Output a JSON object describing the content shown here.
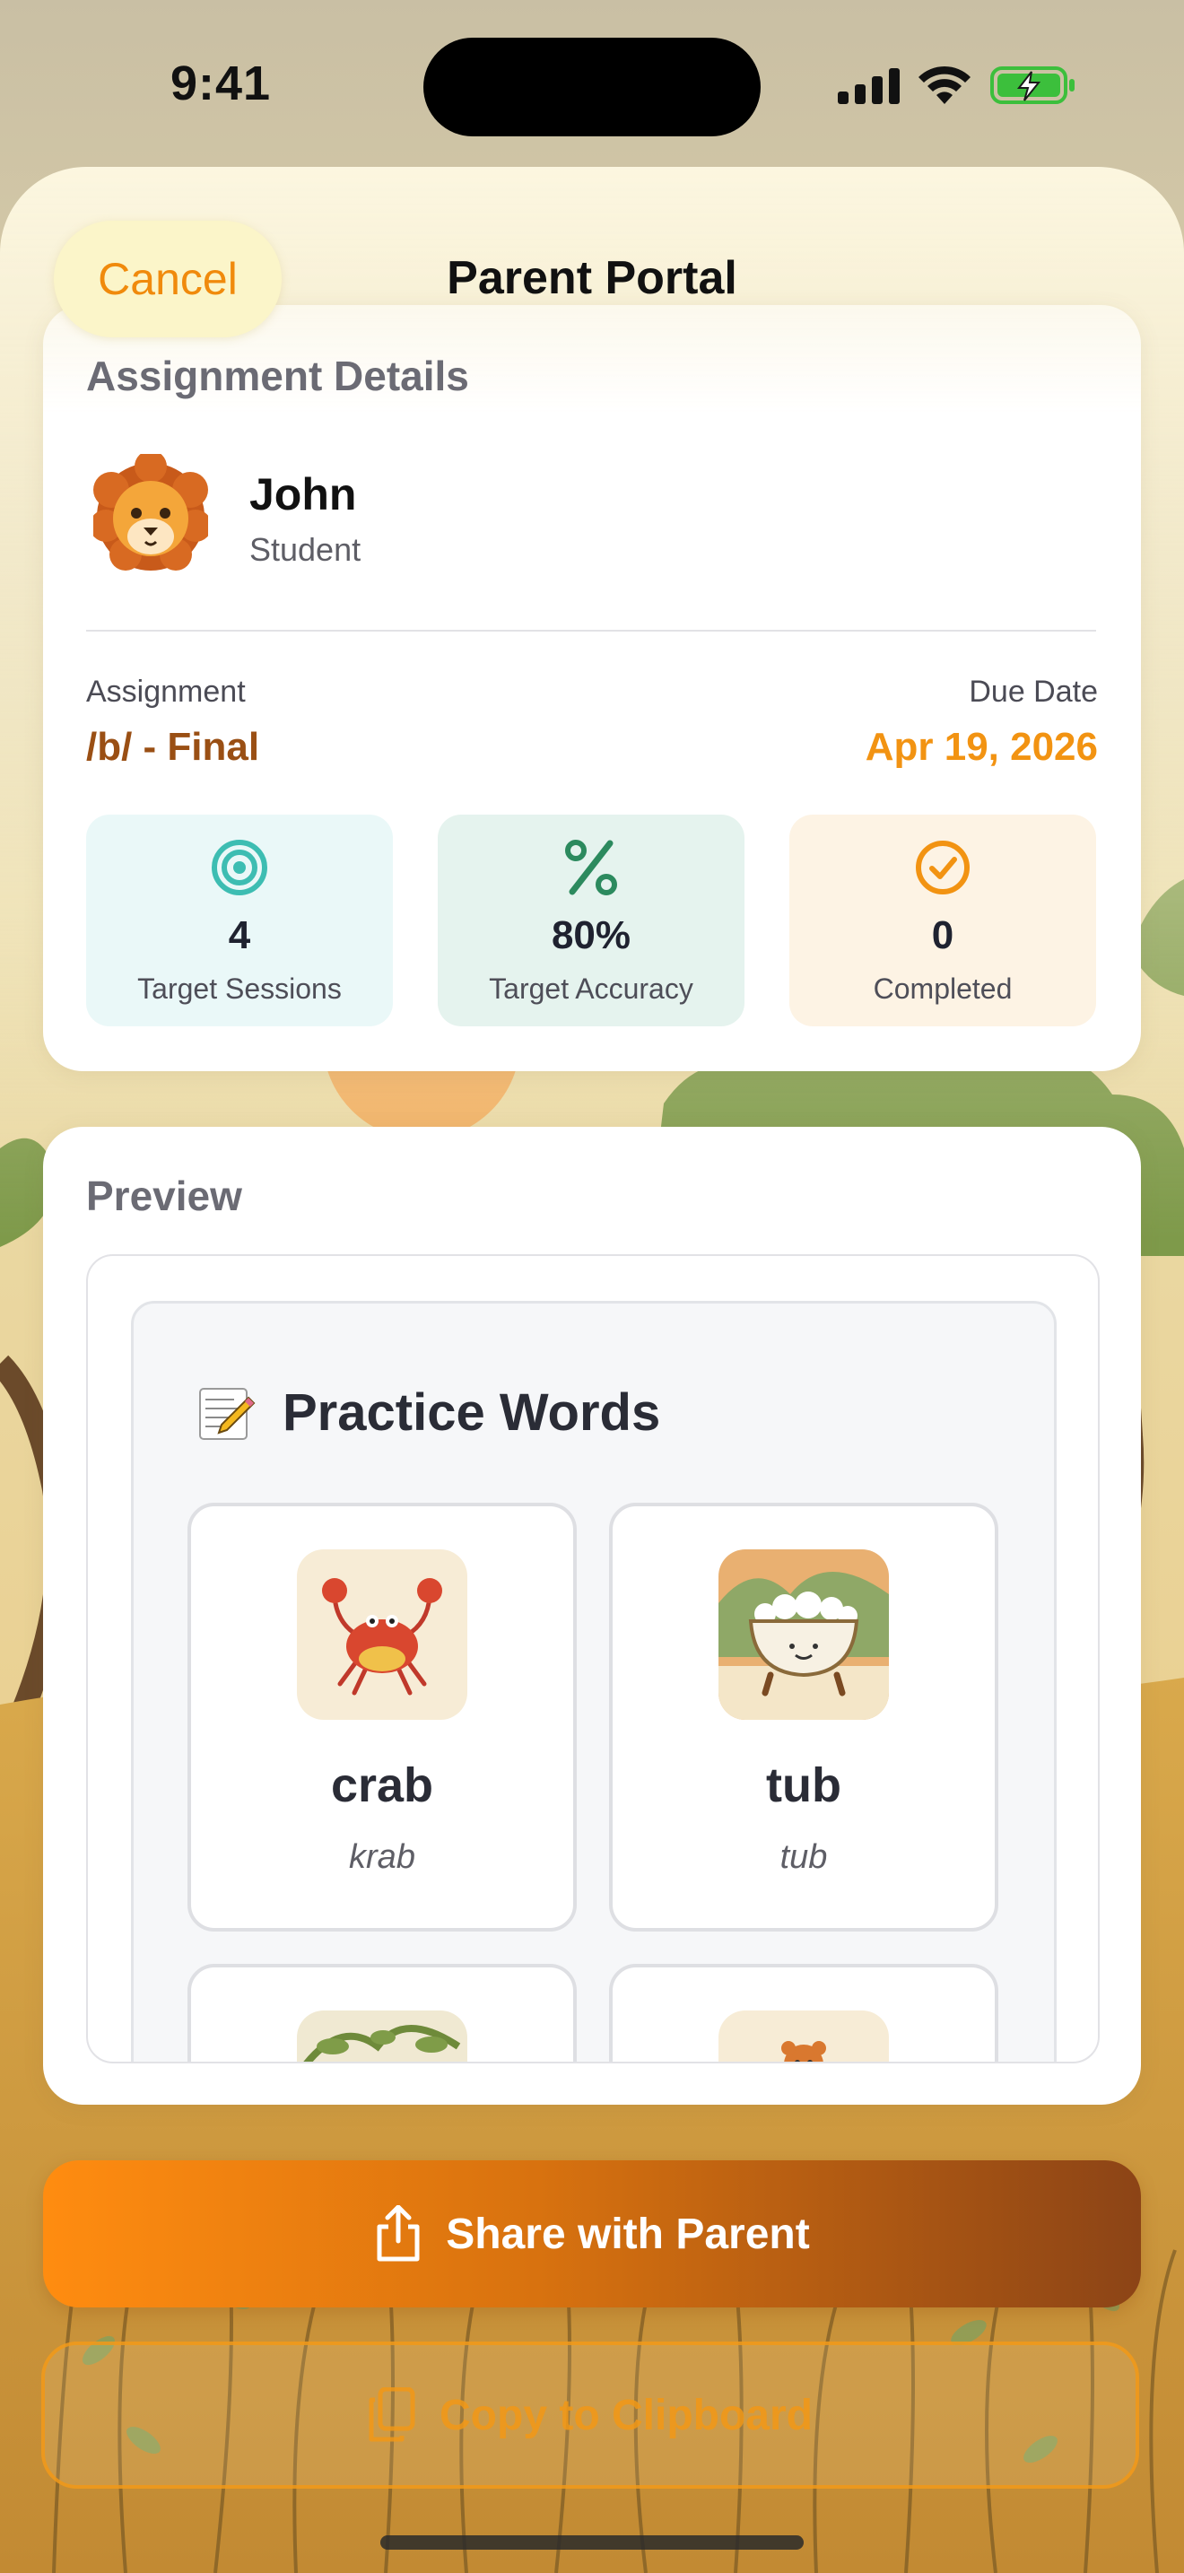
{
  "status_bar": {
    "time": "9:41"
  },
  "nav": {
    "cancel_label": "Cancel",
    "title": "Parent Portal"
  },
  "details": {
    "header": "Assignment Details",
    "student": {
      "name": "John",
      "role": "Student",
      "avatar_icon": "lion-face-icon"
    },
    "assignment_label": "Assignment",
    "assignment_value": "/b/ - Final",
    "due_label": "Due Date",
    "due_value": "Apr 19, 2026",
    "stats": [
      {
        "icon": "target-icon",
        "value": "4",
        "label": "Target Sessions",
        "color": "#3dbdb2"
      },
      {
        "icon": "percent-icon",
        "value": "80%",
        "label": "Target Accuracy",
        "color": "#2c8a5e"
      },
      {
        "icon": "checkmark-circle-icon",
        "value": "0",
        "label": "Completed",
        "color": "#f29312"
      }
    ]
  },
  "preview": {
    "header": "Preview",
    "practice_title": "Practice Words",
    "practice_icon": "memo-icon",
    "words": [
      {
        "word": "crab",
        "pron": "krab",
        "image": "crab-image"
      },
      {
        "word": "tub",
        "pron": "tub",
        "image": "tub-image"
      },
      {
        "word": "",
        "pron": "",
        "image": "web-image"
      },
      {
        "word": "",
        "pron": "",
        "image": "cub-image"
      }
    ]
  },
  "actions": {
    "share_label": "Share with Parent",
    "share_icon": "share-icon",
    "copy_label": "Copy to Clipboard",
    "copy_icon": "clipboard-icon"
  },
  "colors": {
    "accent_orange": "#f29312",
    "assignment_brown": "#9a4f14",
    "share_gradient_start": "#ff8c10",
    "share_gradient_end": "#8c4416"
  }
}
